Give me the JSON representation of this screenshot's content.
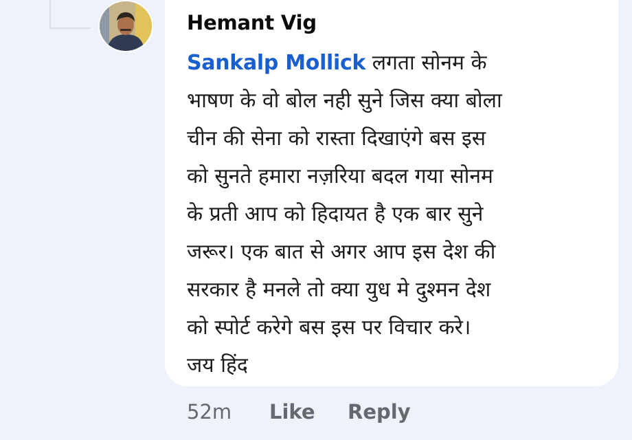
{
  "comment": {
    "author": "Hemant Vig",
    "mention": "Sankalp Mollick",
    "lines": [
      " लगता सोनम के",
      "भाषण के वो बोल नही सुने जिस क्या बोला",
      "चीन की सेना को रास्ता दिखाएंगे बस इस",
      "को सुनते हमारा नज़रिया बदल गया सोनम",
      "के प्रती आप को हिदायत है एक बार सुने",
      "जरूर। एक बात से अगर आप इस देश की",
      "सरकार है मनले तो क्या युध मे दुश्मन देश",
      "को स्पोर्ट करेगे बस इस पर विचार करे।",
      "जय हिंद"
    ]
  },
  "actions": {
    "time": "52m",
    "like": "Like",
    "reply": "Reply"
  },
  "colors": {
    "background": "#eef3fb",
    "bubble": "#ffffff",
    "mention": "#1a5fd0",
    "muted": "#65686d"
  }
}
